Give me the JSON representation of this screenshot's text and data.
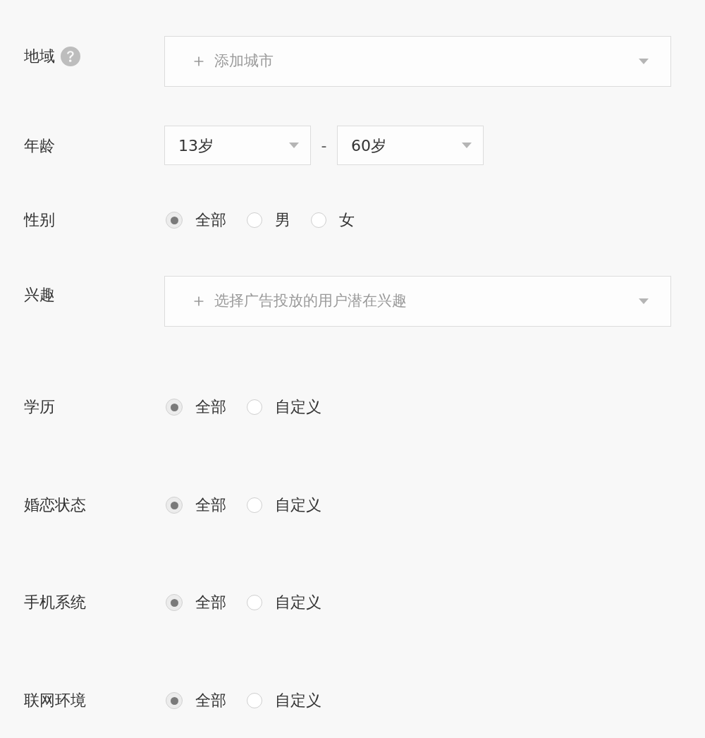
{
  "form": {
    "rows": [
      {
        "kind": "multi_select",
        "label": "地域",
        "help": true,
        "placeholder": "添加城市"
      },
      {
        "kind": "range",
        "label": "年龄",
        "from": {
          "value": "13岁"
        },
        "separator": "-",
        "to": {
          "value": "60岁"
        }
      },
      {
        "kind": "radio",
        "label": "性别",
        "options": [
          {
            "label": "全部",
            "selected": true
          },
          {
            "label": "男",
            "selected": false
          },
          {
            "label": "女",
            "selected": false
          }
        ]
      },
      {
        "kind": "multi_select",
        "label": "兴趣",
        "placeholder": "选择广告投放的用户潜在兴趣"
      },
      {
        "kind": "radio",
        "label": "学历",
        "options": [
          {
            "label": "全部",
            "selected": true
          },
          {
            "label": "自定义",
            "selected": false
          }
        ]
      },
      {
        "kind": "radio",
        "label": "婚恋状态",
        "options": [
          {
            "label": "全部",
            "selected": true
          },
          {
            "label": "自定义",
            "selected": false
          }
        ]
      },
      {
        "kind": "radio",
        "label": "手机系统",
        "options": [
          {
            "label": "全部",
            "selected": true
          },
          {
            "label": "自定义",
            "selected": false
          }
        ]
      },
      {
        "kind": "radio",
        "label": "联网环境",
        "options": [
          {
            "label": "全部",
            "selected": true
          },
          {
            "label": "自定义",
            "selected": false
          }
        ]
      }
    ]
  }
}
